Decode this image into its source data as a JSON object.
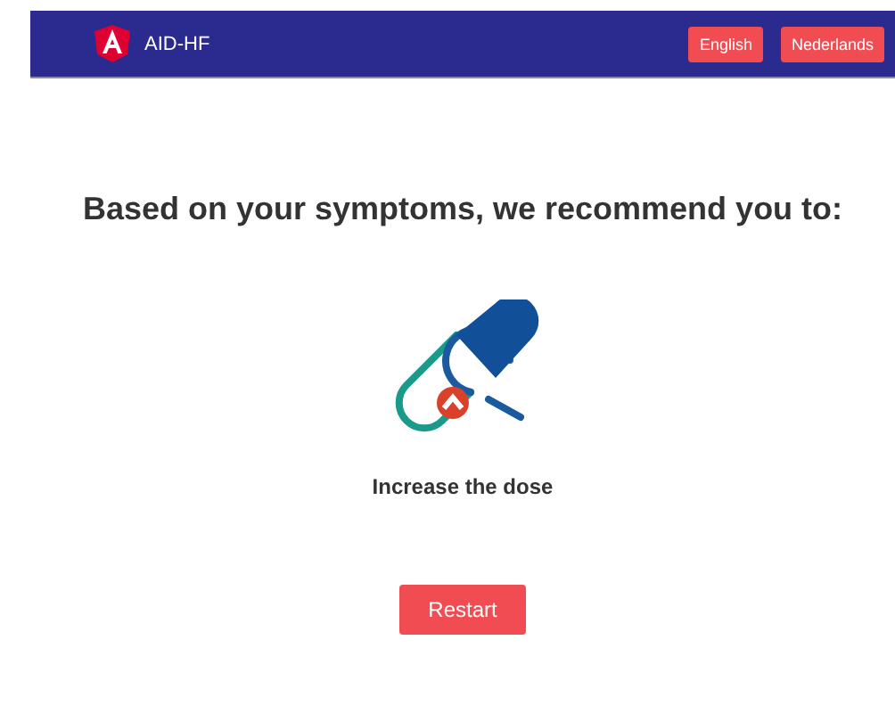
{
  "navbar": {
    "brand": "AID-HF",
    "languages": [
      {
        "label": "English"
      },
      {
        "label": "Nederlands"
      }
    ]
  },
  "recommendation": {
    "heading": "Based on your symptoms, we recommend you to:",
    "advice": "Increase the dose"
  },
  "buttons": [
    {
      "label": "Restart"
    }
  ]
}
